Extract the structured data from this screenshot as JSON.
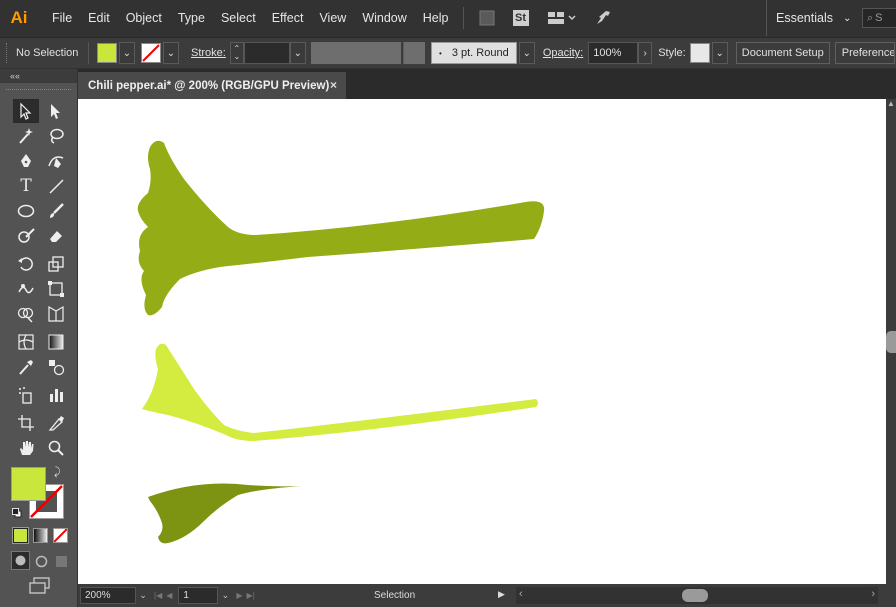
{
  "app": {
    "logo": "Ai",
    "menu": [
      "File",
      "Edit",
      "Object",
      "Type",
      "Select",
      "Effect",
      "View",
      "Window",
      "Help"
    ],
    "stock_label": "St",
    "workspace": "Essentials",
    "search_placeholder": "S"
  },
  "control_bar": {
    "selection_label": "No Selection",
    "fill_color": "#c8e63c",
    "stroke_label": "Stroke:",
    "stroke_profile": "3 pt. Round",
    "opacity_label": "Opacity:",
    "opacity_value": "100%",
    "style_label": "Style:",
    "document_setup": "Document Setup",
    "preferences": "Preferences"
  },
  "document": {
    "tab_title": "Chili pepper.ai* @ 200% (RGB/GPU Preview)",
    "close_symbol": "×"
  },
  "status_bar": {
    "zoom": "200%",
    "artboard": "1",
    "tool_status": "Selection"
  },
  "colors": {
    "shape_top": "#94ad17",
    "shape_middle": "#d4ec3f",
    "shape_bottom": "#7d9312",
    "accent_orange": "#ff9a00"
  },
  "tools": [
    "selection-tool",
    "direct-selection-tool",
    "magic-wand-tool",
    "lasso-tool",
    "pen-tool",
    "curvature-tool",
    "type-tool",
    "line-tool",
    "ellipse-tool",
    "paintbrush-tool",
    "shaper-tool",
    "eraser-tool",
    "rotate-tool",
    "scale-tool",
    "warp-tool",
    "free-transform-tool",
    "shape-builder-tool",
    "perspective-grid-tool",
    "mesh-tool",
    "gradient-tool",
    "eyedropper-tool",
    "blend-tool",
    "symbol-sprayer-tool",
    "column-graph-tool",
    "artboard-tool",
    "slice-tool",
    "hand-tool",
    "zoom-tool"
  ]
}
